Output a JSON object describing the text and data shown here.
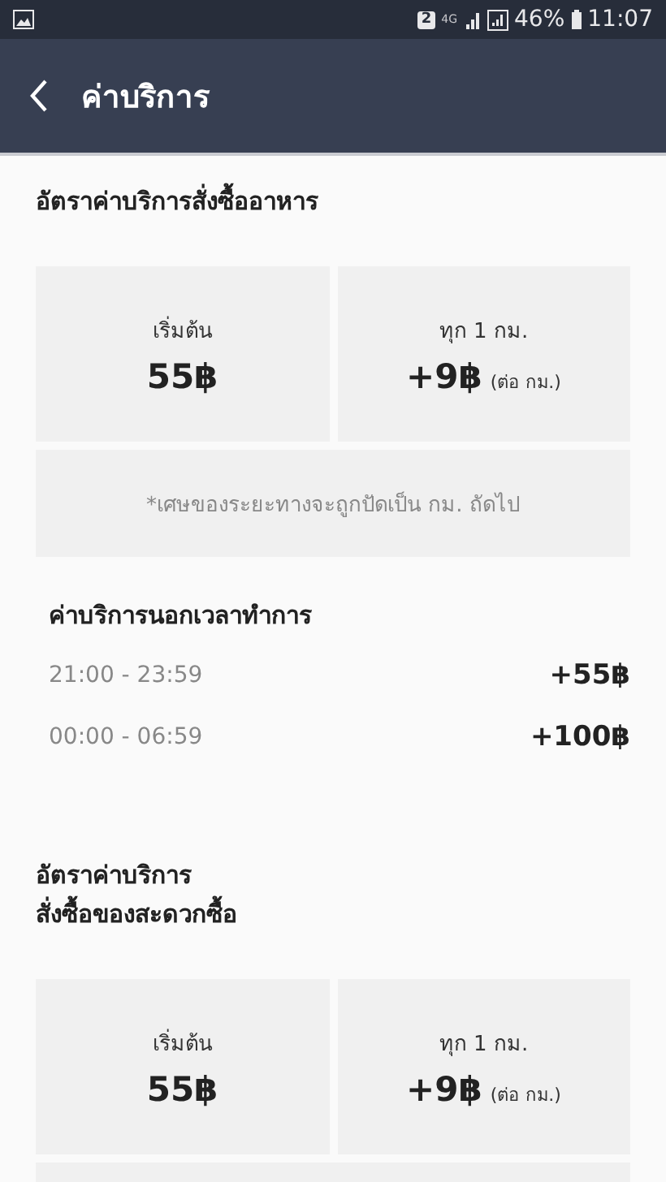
{
  "status_bar": {
    "sim_slot": "2",
    "network": "4G",
    "battery": "46%",
    "time": "11:07"
  },
  "header": {
    "title": "ค่าบริการ"
  },
  "sections": [
    {
      "title": "อัตราค่าบริการสั่งซื้ออาหาร",
      "start_label": "เริ่มต้น",
      "start_price": "55฿",
      "per_km_label": "ทุก 1 กม.",
      "per_km_price": "+9฿",
      "per_km_unit": "(ต่อ กม.)",
      "has_note": true,
      "note": "*เศษของระยะทางจะถูกปัดเป็น กม. ถัดไป",
      "surcharge": {
        "title": "ค่าบริการนอกเวลาทำการ",
        "rows": [
          {
            "time": "21:00 - 23:59",
            "price": "+55฿"
          },
          {
            "time": "00:00 - 06:59",
            "price": "+100฿"
          }
        ]
      }
    },
    {
      "title": "อัตราค่าบริการ\nสั่งซื้อของสะดวกซื้อ",
      "start_label": "เริ่มต้น",
      "start_price": "55฿",
      "per_km_label": "ทุก 1 กม.",
      "per_km_price": "+9฿",
      "per_km_unit": "(ต่อ กม.)",
      "has_note": true
    }
  ]
}
